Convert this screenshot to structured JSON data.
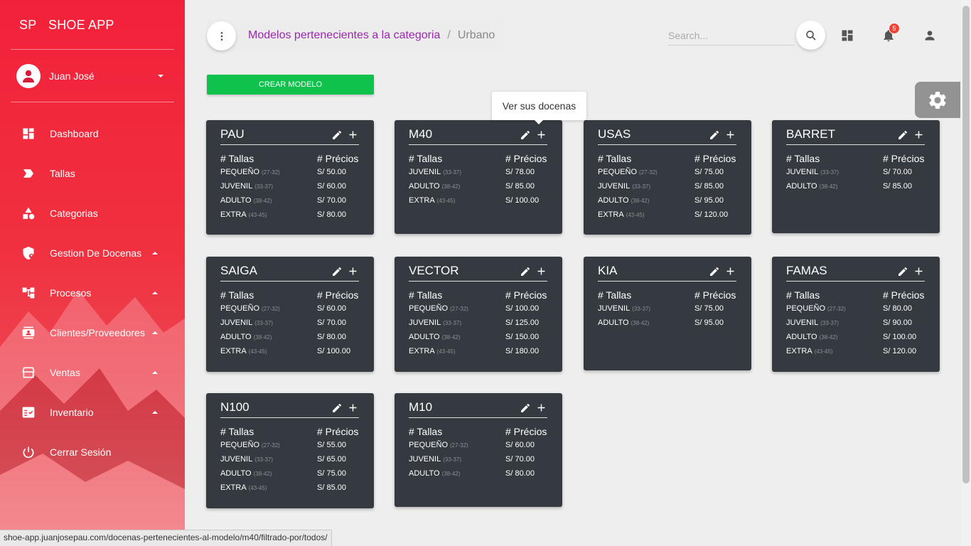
{
  "sidebar": {
    "brand_mini": "SP",
    "brand_name": "SHOE APP",
    "user_name": "Juan José",
    "items": [
      {
        "label": "Dashboard",
        "icon": "dashboard-icon",
        "has_caret": false
      },
      {
        "label": "Tallas",
        "icon": "label-icon",
        "has_caret": false
      },
      {
        "label": "Categorias",
        "icon": "category-icon",
        "has_caret": false
      },
      {
        "label": "Gestion De Docenas",
        "icon": "shield-user-icon",
        "has_caret": true
      },
      {
        "label": "Procesos",
        "icon": "account-tree-icon",
        "has_caret": true
      },
      {
        "label": "Clientes/Proveedores",
        "icon": "contact-icon",
        "has_caret": true
      },
      {
        "label": "Ventas",
        "icon": "store-icon",
        "has_caret": true
      },
      {
        "label": "Inventario",
        "icon": "fact-check-icon",
        "has_caret": true
      },
      {
        "label": "Cerrar Sesión",
        "icon": "power-icon",
        "has_caret": false
      }
    ]
  },
  "header": {
    "breadcrumb_main": "Modelos pertenecientes a la categoria",
    "breadcrumb_sep": "/",
    "breadcrumb_current": "Urbano",
    "search_placeholder": "Search...",
    "notification_count": "5"
  },
  "create_button": "CREAR MODELO",
  "tooltip": "Ver sus docenas",
  "card_headers": {
    "tallas": "# Tallas",
    "precios": "# Précios"
  },
  "cards": [
    {
      "title": "PAU",
      "rows": [
        {
          "size": "PEQUEÑO",
          "range": "(27-32)",
          "price": "S/ 50.00"
        },
        {
          "size": "JUVENIL",
          "range": "(33-37)",
          "price": "S/ 60.00"
        },
        {
          "size": "ADULTO",
          "range": "(38-42)",
          "price": "S/ 70.00"
        },
        {
          "size": "EXTRA",
          "range": "(43-45)",
          "price": "S/ 80.00"
        }
      ]
    },
    {
      "title": "M40",
      "rows": [
        {
          "size": "JUVENIL",
          "range": "(33-37)",
          "price": "S/ 78.00"
        },
        {
          "size": "ADULTO",
          "range": "(38-42)",
          "price": "S/ 85.00"
        },
        {
          "size": "EXTRA",
          "range": "(43-45)",
          "price": "S/ 100.00"
        }
      ]
    },
    {
      "title": "USAS",
      "rows": [
        {
          "size": "PEQUEÑO",
          "range": "(27-32)",
          "price": "S/ 75.00"
        },
        {
          "size": "JUVENIL",
          "range": "(33-37)",
          "price": "S/ 85.00"
        },
        {
          "size": "ADULTO",
          "range": "(38-42)",
          "price": "S/ 95.00"
        },
        {
          "size": "EXTRA",
          "range": "(43-45)",
          "price": "S/ 120.00"
        }
      ]
    },
    {
      "title": "BARRET",
      "rows": [
        {
          "size": "JUVENIL",
          "range": "(33-37)",
          "price": "S/ 70.00"
        },
        {
          "size": "ADULTO",
          "range": "(38-42)",
          "price": "S/ 85.00"
        }
      ]
    },
    {
      "title": "SAIGA",
      "rows": [
        {
          "size": "PEQUEÑO",
          "range": "(27-32)",
          "price": "S/ 60.00"
        },
        {
          "size": "JUVENIL",
          "range": "(33-37)",
          "price": "S/ 70.00"
        },
        {
          "size": "ADULTO",
          "range": "(38-42)",
          "price": "S/ 80.00"
        },
        {
          "size": "EXTRA",
          "range": "(43-45)",
          "price": "S/ 100.00"
        }
      ]
    },
    {
      "title": "VECTOR",
      "rows": [
        {
          "size": "PEQUEÑO",
          "range": "(27-32)",
          "price": "S/ 100.00"
        },
        {
          "size": "JUVENIL",
          "range": "(33-37)",
          "price": "S/ 125.00"
        },
        {
          "size": "ADULTO",
          "range": "(38-42)",
          "price": "S/ 150.00"
        },
        {
          "size": "EXTRA",
          "range": "(43-45)",
          "price": "S/ 180.00"
        }
      ]
    },
    {
      "title": "KIA",
      "rows": [
        {
          "size": "JUVENIL",
          "range": "(33-37)",
          "price": "S/ 75.00"
        },
        {
          "size": "ADULTO",
          "range": "(38-42)",
          "price": "S/ 95.00"
        }
      ]
    },
    {
      "title": "FAMAS",
      "rows": [
        {
          "size": "PEQUEÑO",
          "range": "(27-32)",
          "price": "S/ 80.00"
        },
        {
          "size": "JUVENIL",
          "range": "(33-37)",
          "price": "S/ 90.00"
        },
        {
          "size": "ADULTO",
          "range": "(38-42)",
          "price": "S/ 100.00"
        },
        {
          "size": "EXTRA",
          "range": "(43-45)",
          "price": "S/ 120.00"
        }
      ]
    },
    {
      "title": "N100",
      "rows": [
        {
          "size": "PEQUEÑO",
          "range": "(27-32)",
          "price": "S/ 55.00"
        },
        {
          "size": "JUVENIL",
          "range": "(33-37)",
          "price": "S/ 65.00"
        },
        {
          "size": "ADULTO",
          "range": "(38-42)",
          "price": "S/ 75.00"
        },
        {
          "size": "EXTRA",
          "range": "(43-45)",
          "price": "S/ 85.00"
        }
      ]
    },
    {
      "title": "M10",
      "rows": [
        {
          "size": "PEQUEÑO",
          "range": "(27-32)",
          "price": "S/ 60.00"
        },
        {
          "size": "JUVENIL",
          "range": "(33-37)",
          "price": "S/ 70.00"
        },
        {
          "size": "ADULTO",
          "range": "(38-42)",
          "price": "S/ 80.00"
        }
      ]
    }
  ],
  "status_url": "shoe-app.juanjosepau.com/docenas-pertenecientes-al-modelo/m40/filtrado-por/todos/",
  "colors": {
    "sidebar": "#f2213a",
    "accent": "#9c27b0",
    "create": "#0ec24b",
    "card": "#343a40",
    "badge": "#f44336"
  }
}
